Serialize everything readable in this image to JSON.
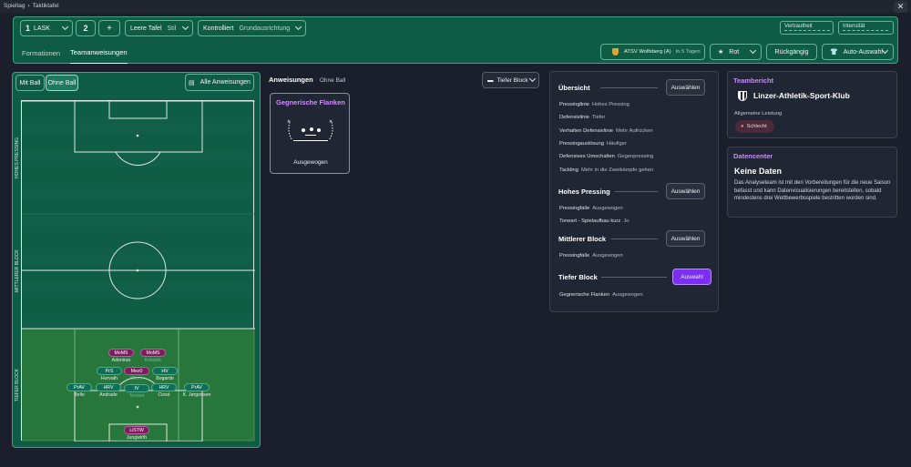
{
  "breadcrumb": [
    "Spieltag",
    "Taktiktafel"
  ],
  "header": {
    "team_select": "LASK",
    "team_number": "1",
    "second_number": "2",
    "add_label": "+",
    "board": {
      "label": "Leere Tafel",
      "sub": "Stil"
    },
    "control": {
      "label": "Kontrolliert",
      "sub": "Grundausrichtung"
    },
    "meters": [
      {
        "label": "Vertrautheit"
      },
      {
        "label": "Intensität"
      }
    ],
    "tabs": [
      "Formationen",
      "Teamanweisungen"
    ],
    "active_tab": "Teamanweisungen",
    "opponent": {
      "name": "ATSV Wolfsberg (A)",
      "when": "In 5 Tagen"
    },
    "rating_button": "Rot",
    "undo_button": "Rückgängig",
    "auto_button": "Auto-Auswahl"
  },
  "field": {
    "toggle": [
      "Mit Ball",
      "Ohne Ball"
    ],
    "all_button": "Alle Anweisungen",
    "zones": [
      "HOHES PRESSING",
      "MITTLERER BLOCK",
      "TIEFER BLOCK"
    ],
    "players": [
      {
        "role": "MoMS",
        "name": "Adeniran",
        "type": "purple"
      },
      {
        "role": "MoMS",
        "name": "Koleptic",
        "type": "purple",
        "dim": true
      },
      {
        "role": "PrS",
        "name": "Horvath",
        "type": "green"
      },
      {
        "role": "Mez0",
        "name": "Okoro",
        "type": "purple",
        "dim": true
      },
      {
        "role": "HV",
        "name": "Bogarde",
        "type": "green"
      },
      {
        "role": "PrAV",
        "name": "Bello",
        "type": "green"
      },
      {
        "role": "HRV",
        "name": "Andrade",
        "type": "green"
      },
      {
        "role": "IV",
        "name": "Tomlen",
        "type": "green",
        "dim": true
      },
      {
        "role": "HRV",
        "name": "Cissé",
        "type": "green"
      },
      {
        "role": "PrAV",
        "name": "K. Jørgensen",
        "type": "green"
      },
      {
        "role": "LiSTW",
        "name": "Jungwirth",
        "type": "purple"
      }
    ]
  },
  "instructions": {
    "title": "Anweisungen",
    "mode": "Ohne Ball",
    "filter": "Tiefer Block",
    "card_title": "Gegnerische Flanken",
    "card_value": "Ausgewogen"
  },
  "overview": {
    "title": "Übersicht",
    "select_label": "Auswählen",
    "selected_label": "Auswahl",
    "rows": [
      {
        "k": "Pressinglinie",
        "v": "Hohes Pressing"
      },
      {
        "k": "Defensivlinie",
        "v": "Tiefer"
      },
      {
        "k": "Verhalten Defensivlinie",
        "v": "Mehr Aufrücken"
      },
      {
        "k": "Pressingauslösung",
        "v": "Häufiger"
      },
      {
        "k": "Defensives Umschalten",
        "v": "Gegenpressing"
      },
      {
        "k": "Tackling",
        "v": "Mehr in die Zweikämpfe gehen"
      }
    ],
    "hp_title": "Hohes Pressing",
    "hp_rows": [
      {
        "k": "Pressingfalle",
        "v": "Ausgewogen"
      },
      {
        "k": "Torwart - Spielaufbau kurz",
        "v": "Jo"
      }
    ],
    "mb_title": "Mittlerer Block",
    "mb_rows": [
      {
        "k": "Pressingfalle",
        "v": "Ausgewogen"
      }
    ],
    "tb_title": "Tiefer Block",
    "tb_rows": [
      {
        "k": "Gegnerische Flanken",
        "v": "Ausgewogen"
      }
    ]
  },
  "report": {
    "title": "Teambericht",
    "club": "Linzer-Athletik-Sport-Klub",
    "perf_label": "Allgemeine Leistung",
    "perf_value": "Schlecht"
  },
  "datacenter": {
    "title": "Datencenter",
    "heading": "Keine Daten",
    "text": "Das Analyseteam ist mit den Vorbereitungen für die neue Saison befasst und kann Datenvisualisierungen bereitstellen, sobald mindestens drei Wettbewerbsspiele bestritten worden sind."
  },
  "colors": {
    "accent": "#7b2ff2",
    "panel": "#0e5c45",
    "report_title": "#c78cff"
  }
}
